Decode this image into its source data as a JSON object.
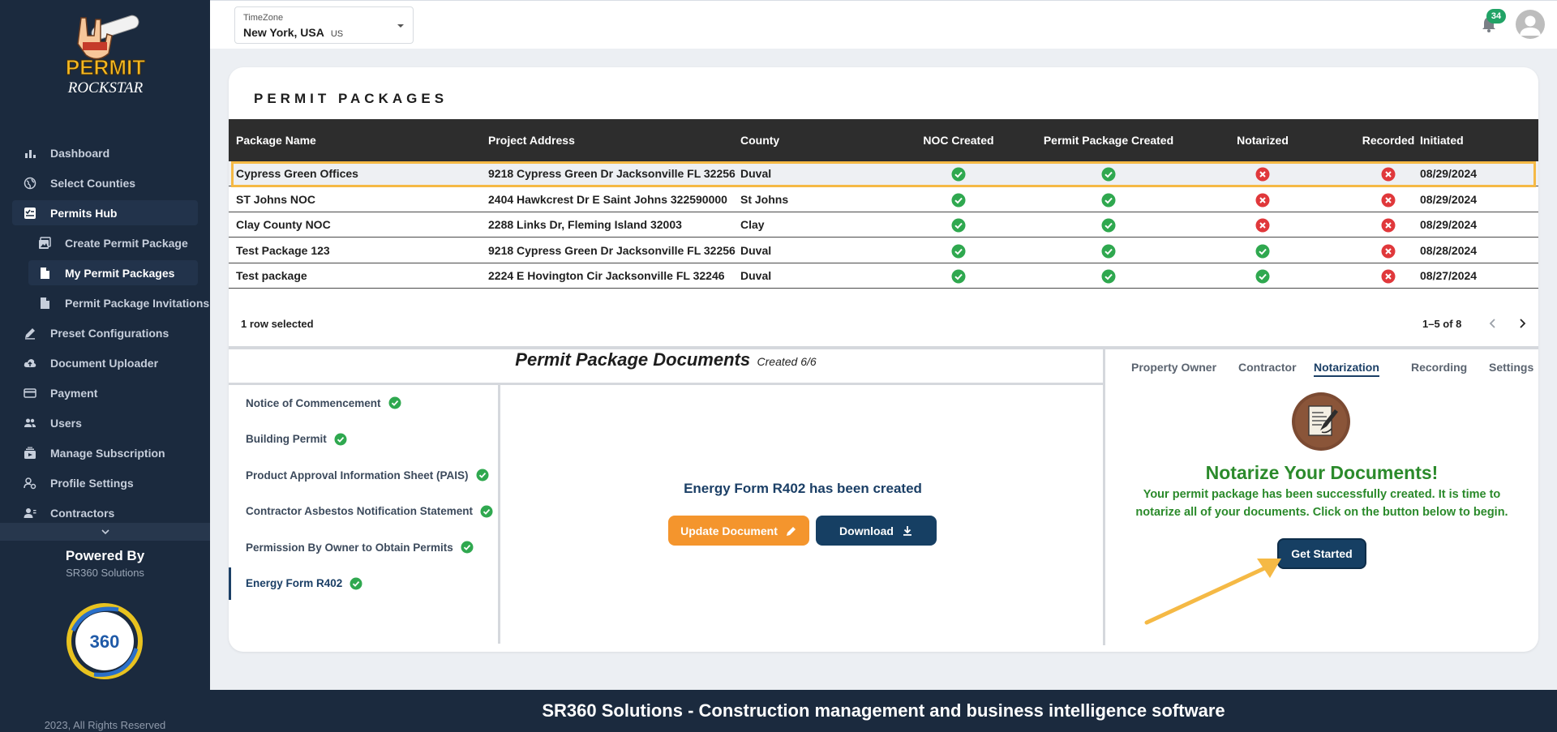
{
  "brand": {
    "logo_text_1": "PERMIT",
    "logo_text_2": "ROCKSTAR"
  },
  "sidebar": {
    "items": [
      {
        "label": "Dashboard",
        "icon": "bar-chart-icon"
      },
      {
        "label": "Select Counties",
        "icon": "globe-icon"
      },
      {
        "label": "Permits Hub",
        "icon": "checklist-icon"
      },
      {
        "label": "Create Permit Package",
        "icon": "image-icon"
      },
      {
        "label": "My Permit Packages",
        "icon": "document-icon"
      },
      {
        "label": "Permit Package Invitations",
        "icon": "document-icon"
      },
      {
        "label": "Preset Configurations",
        "icon": "edit-icon"
      },
      {
        "label": "Document Uploader",
        "icon": "cloud-upload-icon"
      },
      {
        "label": "Payment",
        "icon": "credit-card-icon"
      },
      {
        "label": "Users",
        "icon": "users-icon"
      },
      {
        "label": "Manage Subscription",
        "icon": "subscription-icon"
      },
      {
        "label": "Profile Settings",
        "icon": "profile-settings-icon"
      },
      {
        "label": "Contractors",
        "icon": "contractors-icon"
      }
    ],
    "powered_by": "Powered By",
    "powered_company": "SR360 Solutions",
    "copyright": "2023, All Rights Reserved"
  },
  "topbar": {
    "timezone_label": "TimeZone",
    "timezone_value": "New York, USA",
    "timezone_code": "US",
    "notification_count": "34"
  },
  "packages": {
    "title": "PERMIT PACKAGES",
    "columns": [
      "Package Name",
      "Project Address",
      "County",
      "NOC Created",
      "Permit Package Created",
      "Notarized",
      "Recorded",
      "Initiated"
    ],
    "rows": [
      {
        "name": "Cypress Green Offices",
        "address": "9218 Cypress Green Dr Jacksonville FL 32256",
        "county": "Duval",
        "noc": true,
        "package": true,
        "notarized": false,
        "recorded": false,
        "initiated": "08/29/2024"
      },
      {
        "name": "ST Johns NOC",
        "address": "2404 Hawkcrest Dr E Saint Johns 322590000",
        "county": "St Johns",
        "noc": true,
        "package": true,
        "notarized": false,
        "recorded": false,
        "initiated": "08/29/2024"
      },
      {
        "name": "Clay County NOC",
        "address": "2288 Links Dr, Fleming Island 32003",
        "county": "Clay",
        "noc": true,
        "package": true,
        "notarized": false,
        "recorded": false,
        "initiated": "08/29/2024"
      },
      {
        "name": "Test Package 123",
        "address": "9218 Cypress Green Dr Jacksonville FL 32256",
        "county": "Duval",
        "noc": true,
        "package": true,
        "notarized": true,
        "recorded": false,
        "initiated": "08/28/2024"
      },
      {
        "name": "Test package",
        "address": "2224 E Hovington Cir Jacksonville FL 32246",
        "county": "Duval",
        "noc": true,
        "package": true,
        "notarized": true,
        "recorded": false,
        "initiated": "08/27/2024"
      }
    ],
    "selection_text": "1 row selected",
    "pagination": "1–5 of 8"
  },
  "documents": {
    "title": "Permit Package Documents",
    "subtitle": "Created 6/6",
    "items": [
      "Notice of Commencement",
      "Building Permit",
      "Product Approval Information Sheet (PAIS)",
      "Contractor Asbestos Notification Statement",
      "Permission By Owner to Obtain Permits",
      "Energy Form R402"
    ],
    "created_message": "Energy Form R402 has been created",
    "update_label": "Update Document",
    "download_label": "Download"
  },
  "tabs": [
    "Property Owner",
    "Contractor",
    "Notarization",
    "Recording",
    "Settings"
  ],
  "notarize": {
    "title": "Notarize Your Documents!",
    "text": "Your permit package has been successfully created. It is time to notarize all of your documents. Click on the button below to begin.",
    "button": "Get Started"
  },
  "banner": "SR360 Solutions - Construction management and business intelligence software",
  "colors": {
    "sidebar_bg": "#1b2a3e",
    "accent_orange": "#f4952d",
    "accent_navy": "#163f63",
    "success_green": "#2fa84f",
    "error_red": "#e0383b",
    "selection_outline": "#f5b945"
  }
}
